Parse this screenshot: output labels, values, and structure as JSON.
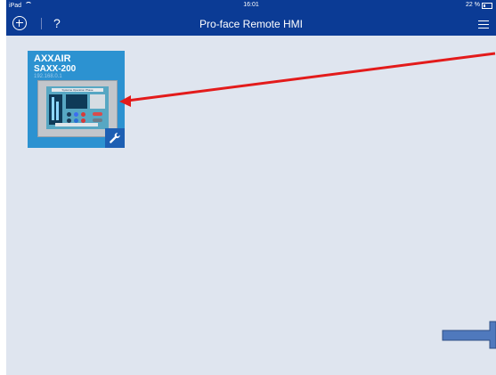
{
  "status_bar": {
    "carrier": "iPad",
    "time": "16:01",
    "battery": "22 %"
  },
  "nav_bar": {
    "title": "Pro-face Remote HMI",
    "help_label": "?"
  },
  "device": {
    "name": "AXXAIR",
    "model": "SAXX-200",
    "ip": "192.168.0.1",
    "thumbnail_title": "Système Operation Phase"
  },
  "icons": {
    "add": "add-circle-icon",
    "help": "help-icon",
    "menu": "menu-icon",
    "settings": "wrench-icon"
  },
  "colors": {
    "nav_background": "#0b3b95",
    "screen_background": "#dfe5ef",
    "tile_background": "#2c92d1",
    "annotation_red": "#e31b1b",
    "annotation_blue": "#4f79bd"
  }
}
